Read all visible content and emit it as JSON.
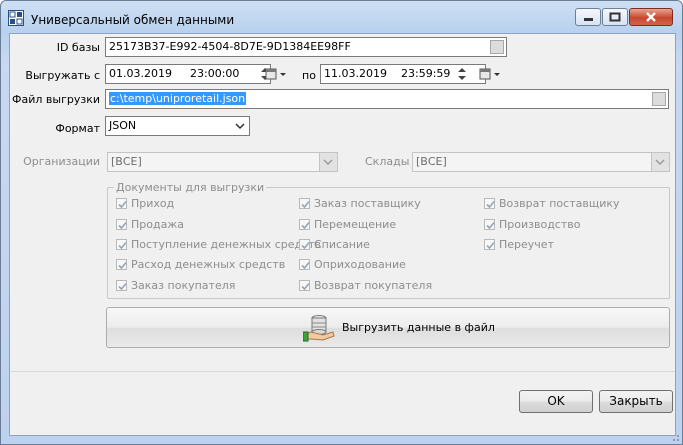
{
  "window": {
    "title": "Универсальный обмен данными",
    "app_icon": "database-exchange-icon"
  },
  "form": {
    "id_label": "ID базы",
    "id_value": "25173B37-E992-4504-8D7E-9D1384EE98FF",
    "export_from_label": "Выгружать с",
    "date_from": "01.03.2019",
    "time_from": "23:00:00",
    "to_label": "по",
    "date_to": "11.03.2019",
    "time_to": "23:59:59",
    "file_label": "Файл выгрузки",
    "file_value": "c:\\temp\\uniproretail.json",
    "format_label": "Формат",
    "format_value": "JSON",
    "org_label": "Организации",
    "org_value": "[ВСЕ]",
    "warehouse_label": "Склады",
    "warehouse_value": "[ВСЕ]"
  },
  "documents": {
    "legend": "Документы для выгрузки",
    "items": [
      {
        "label": "Приход",
        "checked": true
      },
      {
        "label": "Продажа",
        "checked": true
      },
      {
        "label": "Поступление денежных средств",
        "checked": true
      },
      {
        "label": "Расход денежных средств",
        "checked": true
      },
      {
        "label": "Заказ покупателя",
        "checked": true
      },
      {
        "label": "Заказ поставщику",
        "checked": true
      },
      {
        "label": "Перемещение",
        "checked": true
      },
      {
        "label": "Списание",
        "checked": true
      },
      {
        "label": "Оприходование",
        "checked": true
      },
      {
        "label": "Возврат покупателя",
        "checked": true
      },
      {
        "label": "Возврат поставщику",
        "checked": true
      },
      {
        "label": "Производство",
        "checked": true
      },
      {
        "label": "Переучет",
        "checked": true
      }
    ]
  },
  "actions": {
    "export_button": "Выгрузить данные в файл",
    "ok": "OK",
    "close": "Закрыть"
  },
  "colors": {
    "selection": "#3399ff",
    "disabled_text": "#8d8d8d",
    "client_bg": "#f0f0f0"
  }
}
